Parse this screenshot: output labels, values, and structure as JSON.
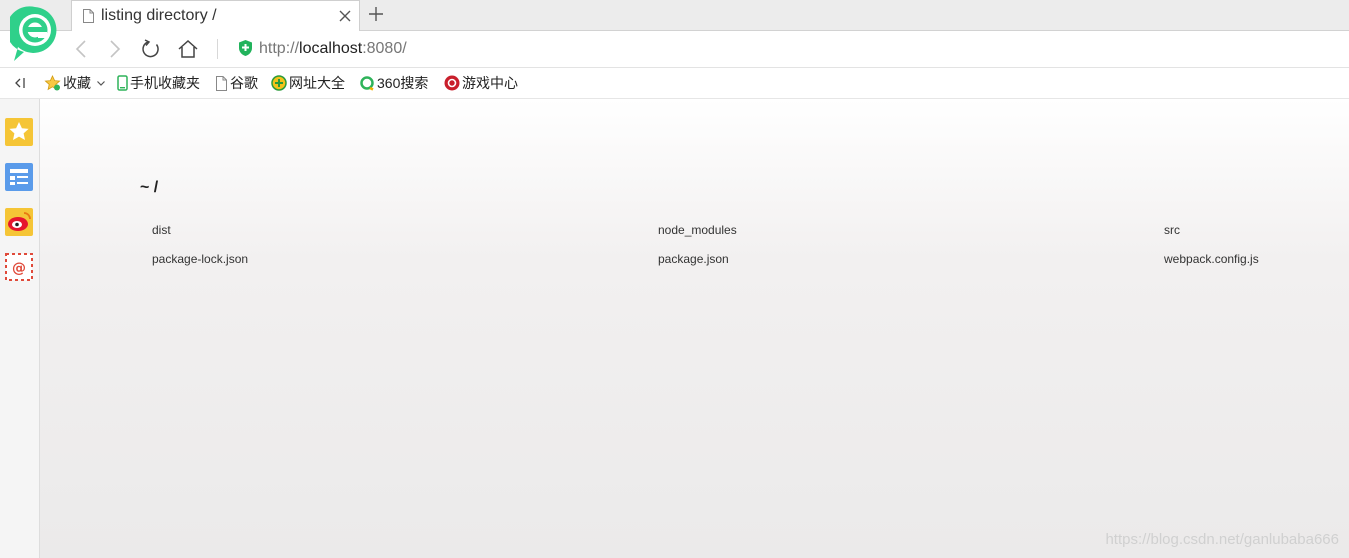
{
  "tab": {
    "title": "listing directory /"
  },
  "address": {
    "scheme": "http://",
    "host": "localhost",
    "port": ":8080/"
  },
  "bookmarks": [
    {
      "label": "收藏",
      "icon": "star-icon"
    },
    {
      "label": "手机收藏夹",
      "icon": "phone-icon"
    },
    {
      "label": "谷歌",
      "icon": "page-icon"
    },
    {
      "label": "网址大全",
      "icon": "globe-icon"
    },
    {
      "label": "360搜索",
      "icon": "search-360-icon"
    },
    {
      "label": "游戏中心",
      "icon": "game-icon"
    }
  ],
  "listing": {
    "heading": "~ /",
    "files": [
      "dist",
      "node_modules",
      "src",
      "package-lock.json",
      "package.json",
      "webpack.config.js"
    ]
  },
  "watermark": "https://blog.csdn.net/ganlubaba666",
  "colors": {
    "logo_green": "#2fd08a",
    "shield_green": "#22b35c",
    "sidebar_bg": "#f5f5f5"
  }
}
